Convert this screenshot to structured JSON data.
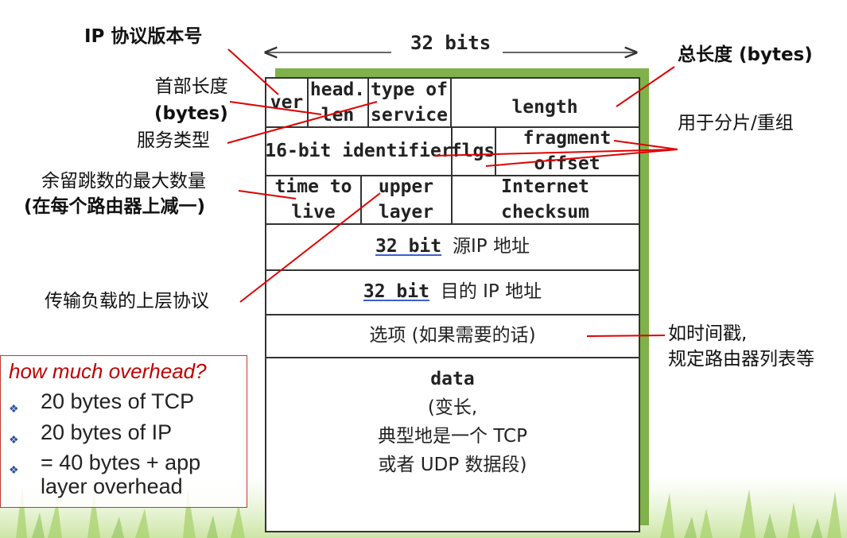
{
  "header": {
    "width_label": "32 bits",
    "rows": {
      "row1": {
        "ver": "ver",
        "head_len": [
          "head.",
          "len"
        ],
        "tos": [
          "type of",
          "service"
        ],
        "length": "length"
      },
      "row2": {
        "identifier": "16-bit identifier",
        "flags": "flgs",
        "frag_offset": [
          "fragment",
          "offset"
        ]
      },
      "row3": {
        "ttl": [
          "time to",
          "live"
        ],
        "upper_layer": [
          "upper",
          "layer"
        ],
        "checksum": [
          "Internet",
          "checksum"
        ]
      },
      "src": {
        "bits": "32 bit",
        "text": "源IP 地址"
      },
      "dst": {
        "bits": "32 bit",
        "text": "目的 IP 地址"
      },
      "options": "选项 (如果需要的话)",
      "data": [
        "data",
        "(变长,",
        "典型地是一个 TCP",
        "或者 UDP 数据段)"
      ]
    }
  },
  "annotations": {
    "ip_version": "IP 协议版本号",
    "header_len": [
      "首部长度",
      "(bytes)"
    ],
    "service_type": "服务类型",
    "ttl": [
      "余留跳数的最大数量",
      "(在每个路由器上减一)"
    ],
    "upper_protocol": "传输负载的上层协议",
    "total_len": "总长度 (bytes)",
    "fragment": "用于分片/重组",
    "options": [
      "如时间戳,",
      "规定路由器列表等"
    ]
  },
  "overhead": {
    "title": "how much overhead?",
    "items": [
      "20 bytes of TCP",
      "20 bytes of IP",
      [
        "= 40 bytes + app",
        "layer overhead"
      ]
    ]
  },
  "colors": {
    "arrow": "#e00000",
    "shadow": "#7fb24a",
    "border": "#333333",
    "overhead_title": "#c00000",
    "bullet": "#2c4fa3"
  }
}
